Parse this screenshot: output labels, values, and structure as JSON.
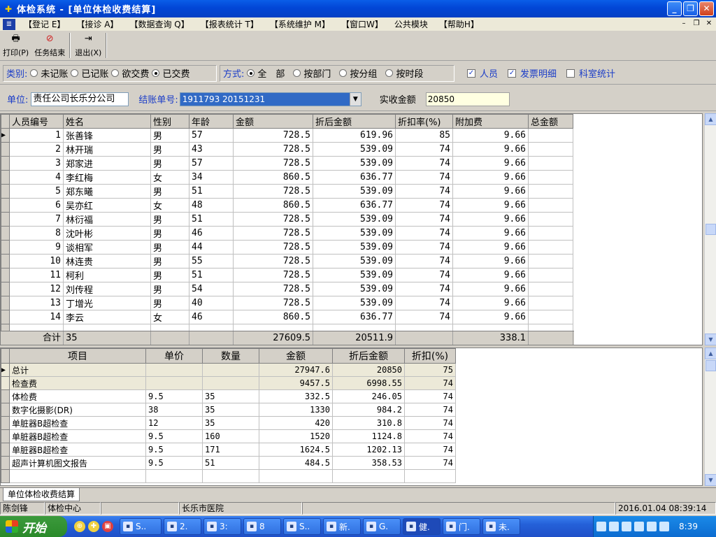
{
  "window": {
    "title": "体检系统 - [单位体检收费结算]"
  },
  "menu": [
    "【登记 E】",
    "【接诊 A】",
    "【数据查询 Q】",
    "【报表统计 T】",
    "【系统维护 M】",
    "【窗口W】",
    "公共模块",
    "【帮助H】"
  ],
  "toolbar": {
    "print": "打印(P)",
    "end_task": "任务结束",
    "exit": "退出(X)"
  },
  "filter": {
    "category_label": "类别:",
    "categories": [
      "未记账",
      "已记账",
      "欲交费",
      "已交费"
    ],
    "category_selected": "已交费",
    "mode_label": "方式:",
    "modes": [
      "全　部",
      "按部门",
      "按分组",
      "按时段"
    ],
    "mode_selected": "全　部",
    "checks": [
      {
        "label": "人员",
        "checked": true
      },
      {
        "label": "发票明细",
        "checked": true
      },
      {
        "label": "科室统计",
        "checked": false
      }
    ]
  },
  "unit": {
    "label": "单位:",
    "value": "责任公司长乐分公司",
    "bill_label": "结账单号:",
    "bill_value": "1911793 20151231",
    "received_label": "实收金额",
    "received_value": "20850"
  },
  "people_table": {
    "columns": [
      "人员编号",
      "姓名",
      "性别",
      "年龄",
      "金额",
      "折后金额",
      "折扣率(%)",
      "附加费",
      "总金额"
    ],
    "rows": [
      [
        "1",
        "张善锋",
        "男",
        "57",
        "728.5",
        "619.96",
        "85",
        "9.66",
        ""
      ],
      [
        "2",
        "林开瑞",
        "男",
        "43",
        "728.5",
        "539.09",
        "74",
        "9.66",
        ""
      ],
      [
        "3",
        "郑家进",
        "男",
        "57",
        "728.5",
        "539.09",
        "74",
        "9.66",
        ""
      ],
      [
        "4",
        "李红梅",
        "女",
        "34",
        "860.5",
        "636.77",
        "74",
        "9.66",
        ""
      ],
      [
        "5",
        "郑东曦",
        "男",
        "51",
        "728.5",
        "539.09",
        "74",
        "9.66",
        ""
      ],
      [
        "6",
        "吴亦红",
        "女",
        "48",
        "860.5",
        "636.77",
        "74",
        "9.66",
        ""
      ],
      [
        "7",
        "林衍福",
        "男",
        "51",
        "728.5",
        "539.09",
        "74",
        "9.66",
        ""
      ],
      [
        "8",
        "沈叶彬",
        "男",
        "46",
        "728.5",
        "539.09",
        "74",
        "9.66",
        ""
      ],
      [
        "9",
        "谈相军",
        "男",
        "44",
        "728.5",
        "539.09",
        "74",
        "9.66",
        ""
      ],
      [
        "10",
        "林连贵",
        "男",
        "55",
        "728.5",
        "539.09",
        "74",
        "9.66",
        ""
      ],
      [
        "11",
        "柯利",
        "男",
        "51",
        "728.5",
        "539.09",
        "74",
        "9.66",
        ""
      ],
      [
        "12",
        "刘传程",
        "男",
        "54",
        "728.5",
        "539.09",
        "74",
        "9.66",
        ""
      ],
      [
        "13",
        "丁增光",
        "男",
        "40",
        "728.5",
        "539.09",
        "74",
        "9.66",
        ""
      ],
      [
        "14",
        "李云",
        "女",
        "46",
        "860.5",
        "636.77",
        "74",
        "9.66",
        ""
      ]
    ],
    "total": {
      "label": "合计",
      "count": "35",
      "amount": "27609.5",
      "discounted": "20511.9",
      "surcharge": "338.1"
    }
  },
  "items_table": {
    "columns": [
      "项目",
      "单价",
      "数量",
      "金额",
      "折后金额",
      "折扣(%)"
    ],
    "rows": [
      {
        "cells": [
          "总计",
          "",
          "",
          "27947.6",
          "20850",
          "75"
        ],
        "grey": true
      },
      {
        "cells": [
          "检查费",
          "",
          "",
          "9457.5",
          "6998.55",
          "74"
        ],
        "grey": true
      },
      {
        "cells": [
          "体检费",
          "9.5",
          "35",
          "332.5",
          "246.05",
          "74"
        ],
        "grey": false
      },
      {
        "cells": [
          "数字化摄影(DR)",
          "38",
          "35",
          "1330",
          "984.2",
          "74"
        ],
        "grey": false
      },
      {
        "cells": [
          "单脏器B超检查",
          "12",
          "35",
          "420",
          "310.8",
          "74"
        ],
        "grey": false
      },
      {
        "cells": [
          "单脏器B超检查",
          "9.5",
          "160",
          "1520",
          "1124.8",
          "74"
        ],
        "grey": false
      },
      {
        "cells": [
          "单脏器B超检查",
          "9.5",
          "171",
          "1624.5",
          "1202.13",
          "74"
        ],
        "grey": false
      },
      {
        "cells": [
          "超声计算机图文报告",
          "9.5",
          "51",
          "484.5",
          "358.53",
          "74"
        ],
        "grey": false
      }
    ]
  },
  "tab": {
    "label": "单位体检收费结算"
  },
  "status": {
    "user": "陈剑锋",
    "dept": "体检中心",
    "hospital": "长乐市医院",
    "datetime": "2016.01.04 08:39:14"
  },
  "taskbar": {
    "start": "开始",
    "tasks": [
      "S..",
      "2.",
      "3:",
      "8",
      "S..",
      "新.",
      "G.",
      "健.",
      "门.",
      "未."
    ],
    "active_task": "健.",
    "clock": "8:39"
  }
}
